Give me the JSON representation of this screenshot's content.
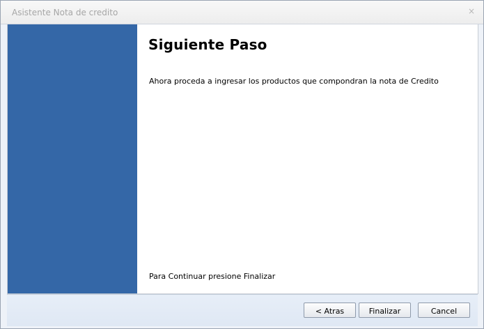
{
  "window": {
    "title": "Asistente Nota de credito",
    "close_glyph": "×"
  },
  "main": {
    "heading": "Siguiente Paso",
    "description": "Ahora proceda a ingresar los productos que compondran la nota de Credito",
    "continue_text": "Para Continuar presione Finalizar"
  },
  "footer": {
    "back_label": "< Atras",
    "finish_label": "Finalizar",
    "cancel_label": "Cancel"
  },
  "colors": {
    "side_panel": "#3467a7",
    "footer": "#e3ebf6"
  }
}
